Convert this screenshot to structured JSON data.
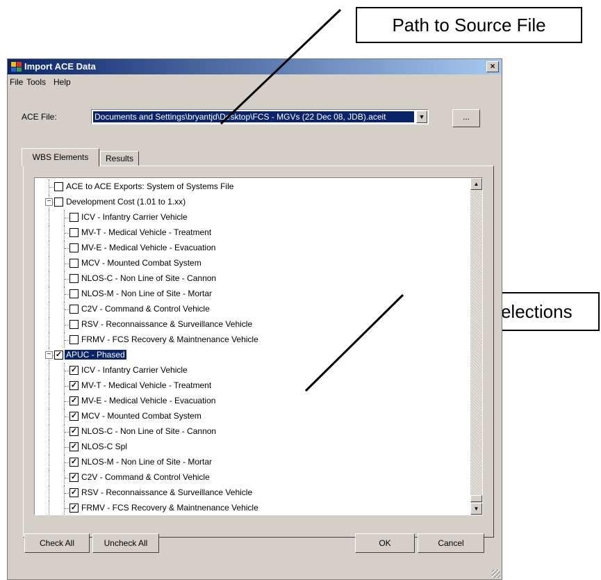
{
  "callouts": {
    "path_label": "Path to Source File",
    "rows_label": "Row Selections"
  },
  "window": {
    "title": "Import ACE Data",
    "close_glyph": "×"
  },
  "menu": [
    "File",
    "Tools",
    "Help"
  ],
  "ace_file": {
    "label": "ACE File:",
    "value": "Documents and Settings\\bryantjd\\Desktop\\FCS - MGVs (22 Dec 08, JDB).aceit",
    "browse_label": "..."
  },
  "tabs": [
    "WBS Elements",
    "Results"
  ],
  "tree": {
    "rows": [
      {
        "label": "ACE to ACE Exports:  System of Systems File",
        "level": 0,
        "checked": false
      },
      {
        "label": "Development Cost (1.01 to 1.xx)",
        "level": 0,
        "checked": false,
        "expander": "−"
      },
      {
        "label": "ICV - Infantry Carrier Vehicle",
        "level": 1,
        "checked": false
      },
      {
        "label": "MV-T - Medical Vehicle - Treatment",
        "level": 1,
        "checked": false
      },
      {
        "label": "MV-E - Medical Vehicle - Evacuation",
        "level": 1,
        "checked": false
      },
      {
        "label": "MCV - Mounted Combat System",
        "level": 1,
        "checked": false
      },
      {
        "label": "NLOS-C - Non Line of Site - Cannon",
        "level": 1,
        "checked": false
      },
      {
        "label": "NLOS-M - Non Line of Site - Mortar",
        "level": 1,
        "checked": false
      },
      {
        "label": "C2V - Command & Control Vehicle",
        "level": 1,
        "checked": false
      },
      {
        "label": "RSV - Reconnaissance & Surveillance Vehicle",
        "level": 1,
        "checked": false
      },
      {
        "label": "FRMV - FCS Recovery & Maintnenance Vehicle",
        "level": 1,
        "checked": false
      },
      {
        "label": "APUC - Phased",
        "level": 0,
        "checked": true,
        "expander": "−",
        "selected": true
      },
      {
        "label": "ICV - Infantry Carrier Vehicle",
        "level": 1,
        "checked": true
      },
      {
        "label": "MV-T - Medical Vehicle - Treatment",
        "level": 1,
        "checked": true
      },
      {
        "label": "MV-E - Medical Vehicle - Evacuation",
        "level": 1,
        "checked": true
      },
      {
        "label": "MCV - Mounted Combat System",
        "level": 1,
        "checked": true
      },
      {
        "label": "NLOS-C - Non Line of Site - Cannon",
        "level": 1,
        "checked": true
      },
      {
        "label": "NLOS-C Spl",
        "level": 1,
        "checked": true
      },
      {
        "label": "NLOS-M - Non Line of Site - Mortar",
        "level": 1,
        "checked": true
      },
      {
        "label": "C2V - Command & Control Vehicle",
        "level": 1,
        "checked": true
      },
      {
        "label": "RSV - Reconnaissance & Surveillance Vehicle",
        "level": 1,
        "checked": true
      },
      {
        "label": "FRMV - FCS Recovery & Maintnenance Vehicle",
        "level": 1,
        "checked": true
      }
    ]
  },
  "buttons": {
    "check_all": "Check All",
    "uncheck_all": "Uncheck All",
    "ok": "OK",
    "cancel": "Cancel"
  }
}
